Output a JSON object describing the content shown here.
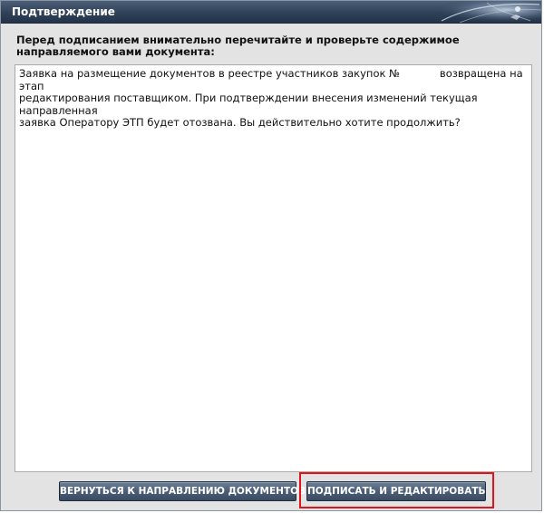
{
  "dialog": {
    "title": "Подтверждение",
    "prompt": "Перед подписанием внимательно перечитайте и проверьте содержимое направляемого вами документа:",
    "document_text": "Заявка на размещение документов в реестре участников закупок №            возвращена на этап\nредактирования поставщиком. При подтверждении внесения изменений текущая направленная\nзаявка Оператору ЭТП будет отозвана. Вы действительно хотите продолжить?"
  },
  "buttons": {
    "back_label": "ВЕРНУТЬСЯ К НАПРАВЛЕНИЮ ДОКУМЕНТОВ",
    "sign_label": "ПОДПИСАТЬ И РЕДАКТИРОВАТЬ"
  },
  "colors": {
    "titlebar": "#2f4158",
    "button": "#4b5e76",
    "highlight": "#e2141b",
    "panel": "#e3e3e3"
  }
}
